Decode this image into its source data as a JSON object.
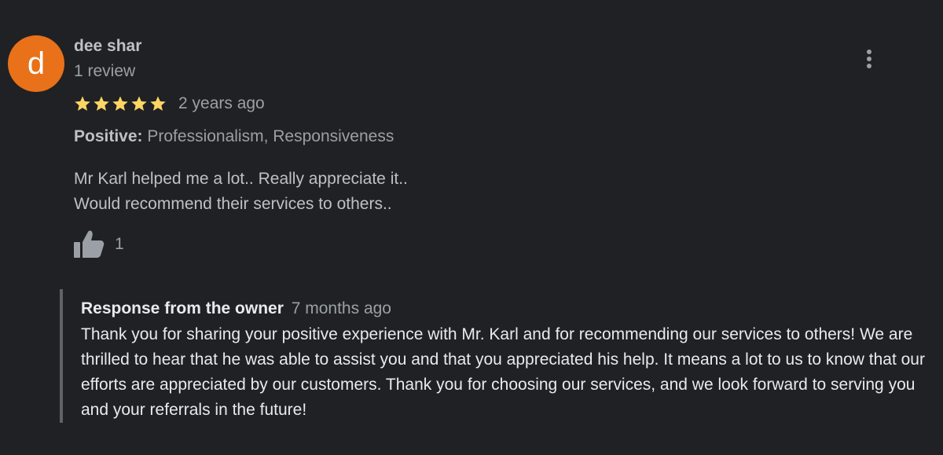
{
  "reviewer": {
    "avatar_letter": "d",
    "avatar_color": "#e8711a",
    "name": "dee shar",
    "review_count": "1 review"
  },
  "review": {
    "rating": 5,
    "max_rating": 5,
    "star_color": "#fdd663",
    "date": "2 years ago",
    "aspect_label": "Positive:",
    "aspect_values": "Professionalism, Responsiveness",
    "text_lines": [
      "Mr Karl helped me a lot.. Really appreciate it..",
      "Would recommend their services to others.."
    ],
    "like_count": "1",
    "more_icon": "more-vert-icon",
    "like_icon": "thumbs-up-icon"
  },
  "owner_response": {
    "title": "Response from the owner",
    "date": "7 months ago",
    "text": "Thank you for sharing your positive experience with Mr. Karl and for recommending our services to others! We are thrilled to hear that he was able to assist you and that you appreciated his help. It means a lot to us to know that our efforts are appreciated by our customers. Thank you for choosing our services, and we look forward to serving you and your referrals in the future!"
  }
}
